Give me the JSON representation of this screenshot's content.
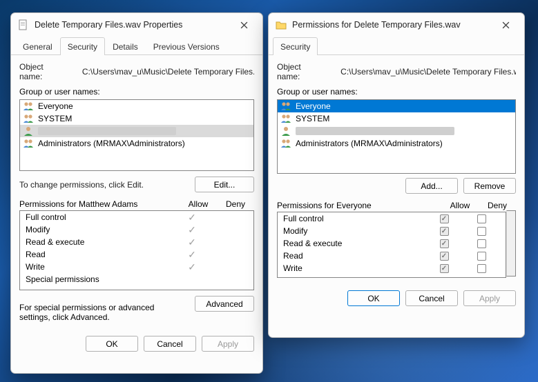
{
  "leftWindow": {
    "title": "Delete Temporary Files.wav Properties",
    "tabs": {
      "general": "General",
      "security": "Security",
      "details": "Details",
      "previous": "Previous Versions"
    },
    "activeTab": "Security",
    "objectNameLabel": "Object name:",
    "objectNameValue": "C:\\Users\\mav_u\\Music\\Delete Temporary Files.wa",
    "groupLabel": "Group or user names:",
    "users": [
      {
        "name": "Everyone",
        "icon": "group"
      },
      {
        "name": "SYSTEM",
        "icon": "group"
      },
      {
        "name": "",
        "icon": "user",
        "redacted": true
      },
      {
        "name": "Administrators (MRMAX\\Administrators)",
        "icon": "group"
      }
    ],
    "changeNote": "To change permissions, click Edit.",
    "editBtn": "Edit...",
    "permHeader": "Permissions for Matthew Adams",
    "allow": "Allow",
    "deny": "Deny",
    "perms": [
      {
        "name": "Full control",
        "allow": true,
        "deny": false
      },
      {
        "name": "Modify",
        "allow": true,
        "deny": false
      },
      {
        "name": "Read & execute",
        "allow": true,
        "deny": false
      },
      {
        "name": "Read",
        "allow": true,
        "deny": false
      },
      {
        "name": "Write",
        "allow": true,
        "deny": false
      },
      {
        "name": "Special permissions",
        "allow": false,
        "deny": false
      }
    ],
    "advNote": "For special permissions or advanced settings, click Advanced.",
    "advBtn": "Advanced",
    "ok": "OK",
    "cancel": "Cancel",
    "apply": "Apply"
  },
  "rightWindow": {
    "title": "Permissions for Delete Temporary Files.wav",
    "tab": "Security",
    "objectNameLabel": "Object name:",
    "objectNameValue": "C:\\Users\\mav_u\\Music\\Delete Temporary Files.wa",
    "groupLabel": "Group or user names:",
    "users": [
      {
        "name": "Everyone",
        "icon": "group",
        "selected": true
      },
      {
        "name": "SYSTEM",
        "icon": "group"
      },
      {
        "name": "",
        "icon": "user",
        "redacted": true
      },
      {
        "name": "Administrators (MRMAX\\Administrators)",
        "icon": "group"
      }
    ],
    "addBtn": "Add...",
    "removeBtn": "Remove",
    "permHeader": "Permissions for Everyone",
    "allow": "Allow",
    "deny": "Deny",
    "perms": [
      {
        "name": "Full control",
        "allow": true,
        "deny": false
      },
      {
        "name": "Modify",
        "allow": true,
        "deny": false
      },
      {
        "name": "Read & execute",
        "allow": true,
        "deny": false
      },
      {
        "name": "Read",
        "allow": true,
        "deny": false
      },
      {
        "name": "Write",
        "allow": true,
        "deny": false
      }
    ],
    "ok": "OK",
    "cancel": "Cancel",
    "apply": "Apply"
  }
}
